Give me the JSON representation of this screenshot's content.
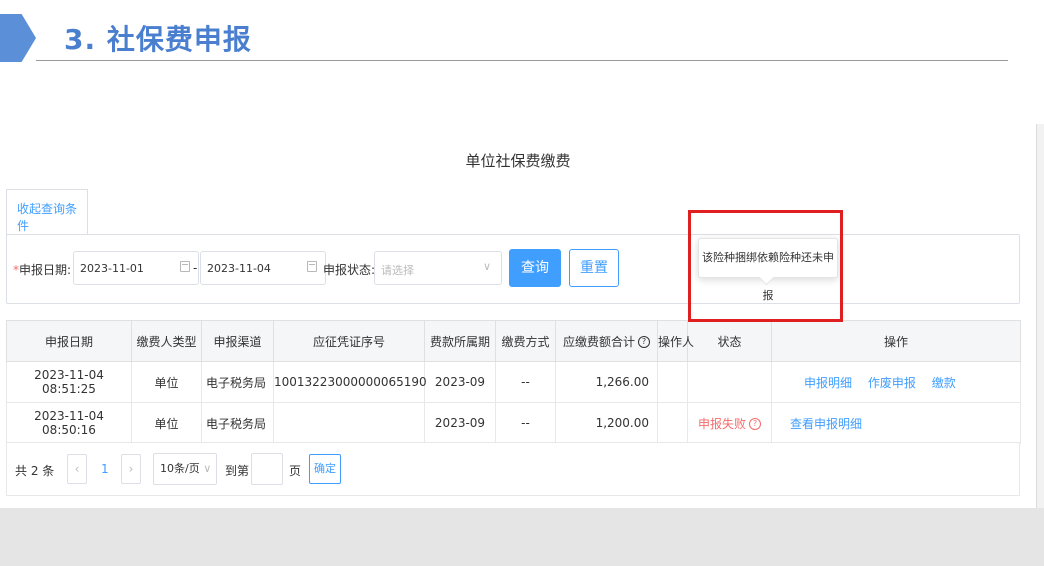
{
  "section": {
    "title": "3. 社保费申报"
  },
  "page": {
    "heading": "单位社保费缴费"
  },
  "tab": {
    "label": "收起查询条件"
  },
  "filter": {
    "date_label": "申报日期:",
    "date_from": "2023-11-01",
    "date_sep": "-",
    "date_to": "2023-11-04",
    "status_label": "申报状态:",
    "status_placeholder": "请选择",
    "query_button": "查询",
    "reset_button": "重置"
  },
  "table": {
    "headers": [
      "申报日期",
      "缴费人类型",
      "申报渠道",
      "应征凭证序号",
      "费款所属期",
      "缴费方式",
      "应缴费额合计",
      "操作人",
      "状态",
      "操作"
    ],
    "rows": [
      {
        "date": "2023-11-04 08:51:25",
        "payer_type": "单位",
        "channel": "电子税务局",
        "voucher": "10013223000000065190",
        "period": "2023-09",
        "method": "--",
        "amount": "1,266.00",
        "operator": "",
        "status": "",
        "actions": [
          "申报明细",
          "作废申报",
          "缴款"
        ]
      },
      {
        "date": "2023-11-04 08:50:16",
        "payer_type": "单位",
        "channel": "电子税务局",
        "voucher": "",
        "period": "2023-09",
        "method": "--",
        "amount": "1,200.00",
        "operator": "",
        "status": "申报失败",
        "actions": [
          "查看申报明细"
        ]
      }
    ]
  },
  "tooltip": {
    "text": "该险种捆绑依赖险种还未申报"
  },
  "pager": {
    "total": "共 2 条",
    "page": "1",
    "page_size": "10条/页",
    "goto_label": "到第",
    "page_unit": "页",
    "confirm": "确定"
  },
  "colors": {
    "accent": "#409eff",
    "title": "#4a7fd0",
    "error": "#f56c6c",
    "highlight": "#e02020"
  }
}
